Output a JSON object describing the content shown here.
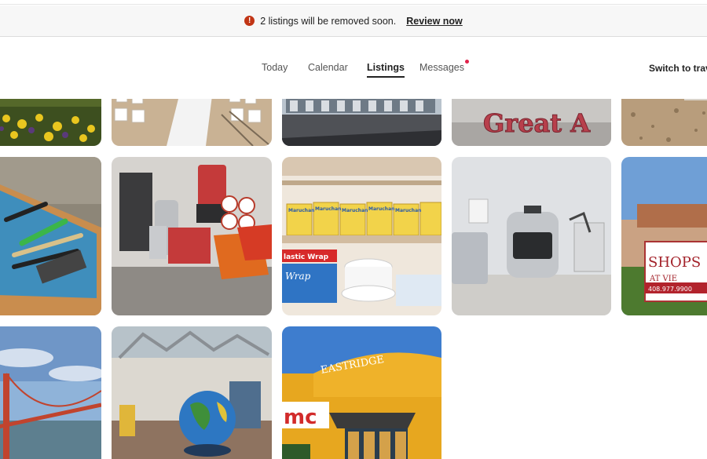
{
  "banner": {
    "icon": "alert-circle-icon",
    "icon_glyph": "!",
    "message": "2 listings will be removed soon.",
    "link_label": "Review now",
    "accent_color": "#c13515"
  },
  "nav": {
    "tabs": [
      {
        "label": "Today"
      },
      {
        "label": "Calendar"
      },
      {
        "label": "Listings",
        "active": true
      },
      {
        "label": "Messages",
        "has_notification": true
      }
    ],
    "switch_label": "Switch to trav",
    "notification_color": "#e0224a"
  },
  "photos": [
    {
      "subject": "flower-bed"
    },
    {
      "subject": "event-chairs-aisle"
    },
    {
      "subject": "building-parking-lot"
    },
    {
      "subject": "great-america-sign",
      "visible_text": "Great A"
    },
    {
      "subject": "gravel-ground"
    },
    {
      "subject": "kitchen-utensil-drawer"
    },
    {
      "subject": "coffee-station"
    },
    {
      "subject": "pantry-shelf",
      "visible_text": "Maruchan Instant Lunch, Plastic Wrap"
    },
    {
      "subject": "rice-cooker-counter"
    },
    {
      "subject": "shops-at-sign",
      "visible_text": "SHOPS AT VIE, 408.977.9900"
    },
    {
      "subject": "golden-gate-bridge"
    },
    {
      "subject": "museum-globe"
    },
    {
      "subject": "amc-eastridge",
      "visible_text": "EASTRIDGE, amc"
    }
  ]
}
